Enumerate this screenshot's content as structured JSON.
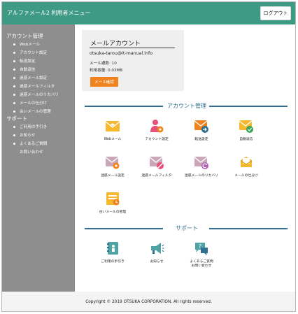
{
  "header": {
    "title": "アルファメール2 利用者メニュー",
    "logout_label": "ログアウト"
  },
  "sidebar": {
    "account_heading": "アカウント管理",
    "account_items": [
      {
        "label": "Webメール"
      },
      {
        "label": "アカウント設定"
      },
      {
        "label": "転送設定"
      },
      {
        "label": "自動返信"
      },
      {
        "label": "迷惑メール設定"
      },
      {
        "label": "迷惑メールフィルタ"
      },
      {
        "label": "迷惑メールのリカバリ"
      },
      {
        "label": "メールの仕分け"
      },
      {
        "label": "古いメールの管理"
      }
    ],
    "support_heading": "サポート",
    "support_items": [
      {
        "label": "ご利用の手引き"
      },
      {
        "label": "お知らせ"
      },
      {
        "label": "よくあるご質問"
      },
      {
        "label": "お問い合わせ"
      }
    ]
  },
  "account_card": {
    "title": "メールアカウント",
    "email": "otsuka-tarou@it-manual.info",
    "mail_count": "メール通数: 10",
    "usage": "利用容量: 0.03MB",
    "confirm_label": "メール確認"
  },
  "account_section": {
    "title": "アカウント管理",
    "tiles": [
      {
        "label": "Webメール",
        "icon": "webmail-icon"
      },
      {
        "label": "アカウント設定",
        "icon": "account-settings-icon"
      },
      {
        "label": "転送設定",
        "icon": "forward-settings-icon"
      },
      {
        "label": "自動返信",
        "icon": "auto-reply-icon"
      },
      {
        "label": "迷惑メール設定",
        "icon": "spam-settings-icon"
      },
      {
        "label": "迷惑メールフィルタ",
        "icon": "spam-filter-icon"
      },
      {
        "label": "迷惑メールのリカバリ",
        "icon": "spam-recovery-icon"
      },
      {
        "label": "メールの仕分け",
        "icon": "mail-sorting-icon"
      },
      {
        "label": "古いメールの管理",
        "icon": "old-mail-icon"
      }
    ]
  },
  "support_section": {
    "title": "サポート",
    "tiles": [
      {
        "label": "ご利用の手引き",
        "icon": "guide-book-icon"
      },
      {
        "label": "お知らせ",
        "icon": "megaphone-icon"
      },
      {
        "label": "よくあるご質問",
        "label2": "お問い合わせ",
        "icon": "faq-chat-icon"
      }
    ]
  },
  "footer": {
    "copyright": "Copyright © 2019 OTSUKA CORPORATION. All rights reserved."
  },
  "colors": {
    "header": "#3e9a84",
    "sidebar": "#8e8e8e",
    "accent_orange": "#f0831f",
    "icon_yellow": "#f5b82e",
    "icon_pink": "#e6507a",
    "icon_blue": "#2f6f8f",
    "icon_green": "#3aa35a",
    "icon_teal": "#4fa3a5",
    "section_line": "#2f6f8f"
  }
}
